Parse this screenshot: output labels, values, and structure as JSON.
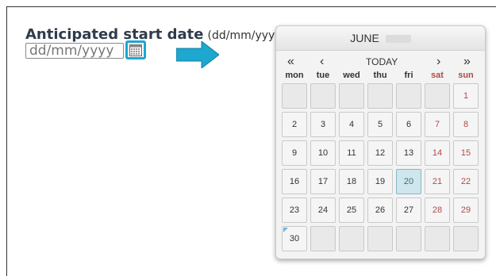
{
  "form": {
    "label_main": "Anticipated start date",
    "label_hint": "(dd/mm/yyyy)",
    "input_placeholder": "dd/mm/yyyy"
  },
  "calendar": {
    "month": "JUNE",
    "nav": {
      "prev_year": "«",
      "prev_month": "‹",
      "today": "TODAY",
      "next_month": "›",
      "next_year": "»"
    },
    "weekdays": [
      "mon",
      "tue",
      "wed",
      "thu",
      "fri",
      "sat",
      "sun"
    ],
    "weeks": [
      [
        "",
        "",
        "",
        "",
        "",
        "",
        "1"
      ],
      [
        "2",
        "3",
        "4",
        "5",
        "6",
        "7",
        "8"
      ],
      [
        "9",
        "10",
        "11",
        "12",
        "13",
        "14",
        "15"
      ],
      [
        "16",
        "17",
        "18",
        "19",
        "20",
        "21",
        "22"
      ],
      [
        "23",
        "24",
        "25",
        "26",
        "27",
        "28",
        "29"
      ],
      [
        "30",
        "",
        "",
        "",
        "",
        "",
        ""
      ]
    ],
    "selected_day": "20",
    "today_day": "30"
  },
  "colors": {
    "accent": "#1ea7cf",
    "weekend": "#b04a4a",
    "selected_bg": "#cfe6ec"
  },
  "icons": {
    "calendar_button": "calendar-icon",
    "pointer": "arrow-right-icon"
  }
}
